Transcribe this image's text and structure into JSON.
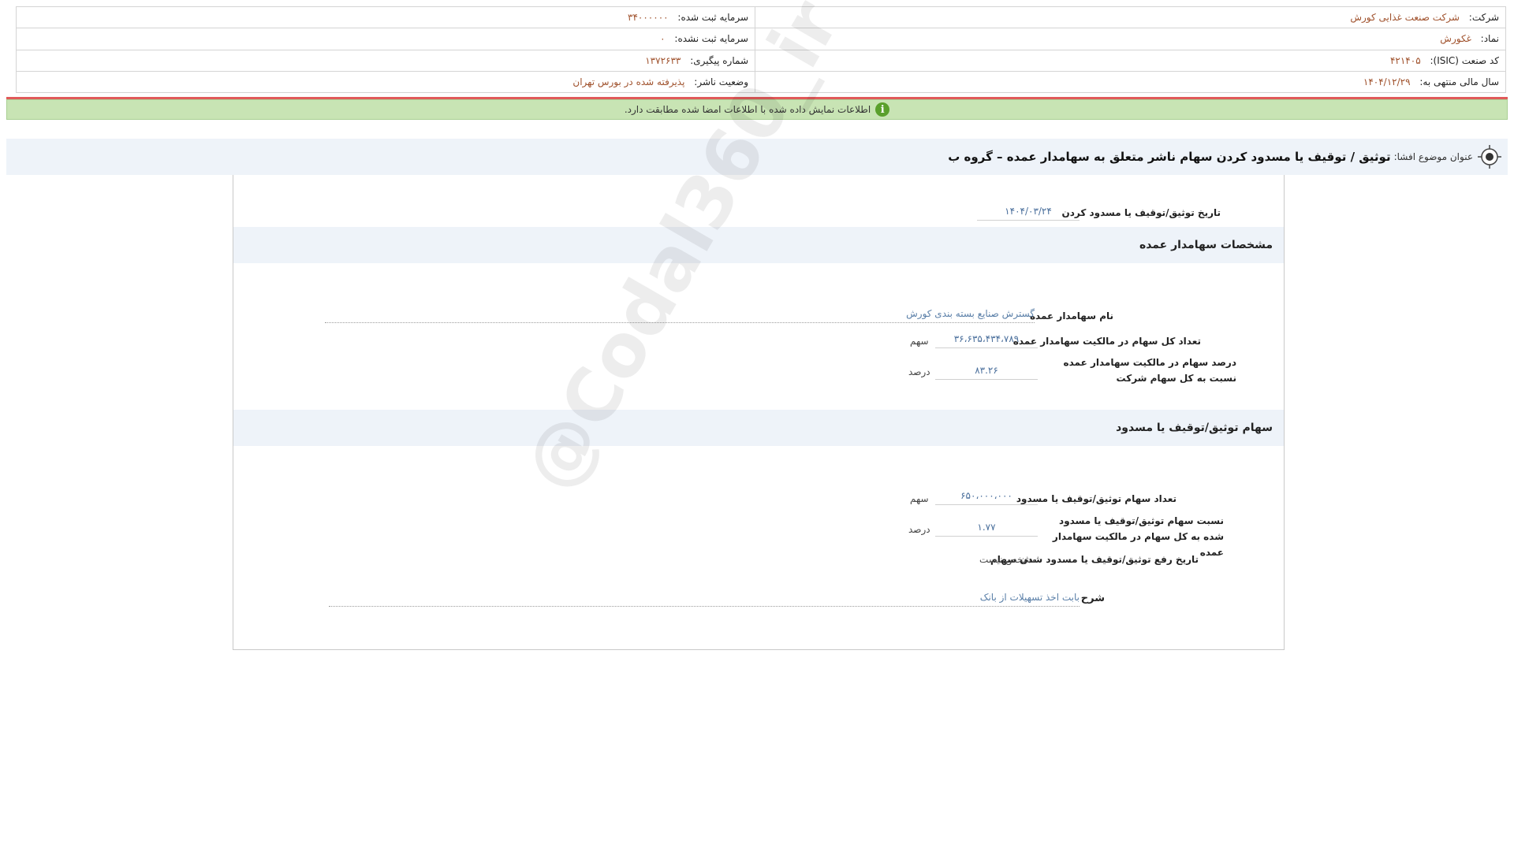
{
  "header": {
    "company_label": "شرکت:",
    "company_value": "شرکت صنعت غذایی کورش",
    "capital_registered_label": "سرمایه ثبت شده:",
    "capital_registered_value": "۳۴۰۰۰۰۰۰",
    "symbol_label": "نماد:",
    "symbol_value": "غکورش",
    "capital_unregistered_label": "سرمایه ثبت نشده:",
    "capital_unregistered_value": "۰",
    "isic_label": "کد صنعت (ISIC):",
    "isic_value": "۴۲۱۴۰۵",
    "tracking_label": "شماره پیگیری:",
    "tracking_value": "۱۳۷۲۶۳۳",
    "fiscal_label": "سال مالی منتهی به:",
    "fiscal_value": "۱۴۰۴/۱۲/۲۹",
    "status_label": "وضعیت ناشر:",
    "status_value": "پذیرفته شده در بورس تهران"
  },
  "banner": {
    "text": "اطلاعات نمایش داده شده با اطلاعات امضا شده مطابقت دارد.",
    "icon": "info-icon",
    "color": "#c8e4b4"
  },
  "title_bar": {
    "label": "عنوان موضوع افشا:",
    "title": "توثیق / توقیف یا مسدود کردن سهام ناشر متعلق به سهامدار عمده – گروه ب"
  },
  "form": {
    "date_label": "تاریخ توثیق/توقیف یا مسدود کردن",
    "date_value": "۱۴۰۴/۰۳/۲۴",
    "section1_title": "مشخصات سهامدار عمده",
    "shareholder_name_label": "نام سهامدار عمده",
    "shareholder_name_value": "گسترش صنایع بسته بندی کورش",
    "total_shares_label": "تعداد کل سهام در مالکیت سهامدار عمده",
    "total_shares_value": "۳۶،۶۳۵،۴۳۴،۷۸۹",
    "total_shares_unit": "سهم",
    "percent_label": "درصد سهام در مالکیت سهامدار عمده نسبت به کل سهام شرکت",
    "percent_value": "۸۳.۲۶",
    "percent_unit": "درصد",
    "section2_title": "سهام توثیق/توقیف یا مسدود",
    "blocked_count_label": "تعداد سهام توثیق/توقیف یا مسدود",
    "blocked_count_value": "۶۵۰،۰۰۰،۰۰۰",
    "blocked_count_unit": "سهم",
    "blocked_ratio_label": "نسبت سهام توثیق/توقیف یا مسدود شده به کل سهام در مالکیت سهامدار عمده",
    "blocked_ratio_value": "۱.۷۷",
    "blocked_ratio_unit": "درصد",
    "release_date_label": "تاریخ رفع توثیق/توقیف یا مسدود شدن سهام",
    "release_date_value": "مشخص نیست",
    "description_label": "شرح",
    "description_value": "بابت اخذ تسهیلات از بانک"
  },
  "watermark": "@Codal360_ir"
}
